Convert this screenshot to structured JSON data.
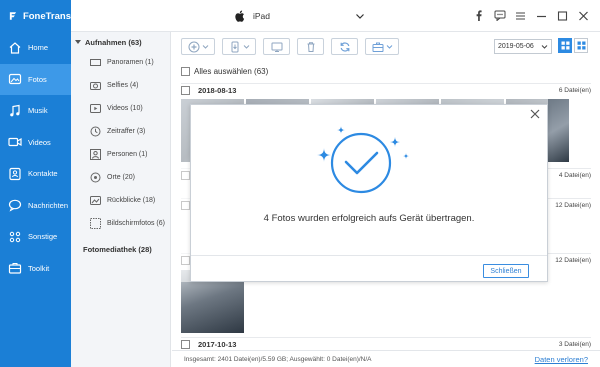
{
  "app": {
    "name": "FoneTrans"
  },
  "device": {
    "name": "iPad"
  },
  "sidebar": {
    "items": [
      {
        "label": "Home",
        "icon": "home-icon"
      },
      {
        "label": "Fotos",
        "icon": "photo-icon",
        "active": true
      },
      {
        "label": "Musik",
        "icon": "music-icon"
      },
      {
        "label": "Videos",
        "icon": "video-icon"
      },
      {
        "label": "Kontakte",
        "icon": "contacts-icon"
      },
      {
        "label": "Nachrichten",
        "icon": "messages-icon"
      },
      {
        "label": "Sonstige",
        "icon": "other-icon"
      },
      {
        "label": "Toolkit",
        "icon": "toolkit-icon"
      }
    ]
  },
  "categories": {
    "header": "Aufnahmen (63)",
    "items": [
      {
        "label": "Panoramen (1)",
        "icon": "panorama-icon"
      },
      {
        "label": "Selfies (4)",
        "icon": "camera-icon"
      },
      {
        "label": "Videos (10)",
        "icon": "video-icon"
      },
      {
        "label": "Zeitraffer (3)",
        "icon": "timelapse-icon"
      },
      {
        "label": "Personen (1)",
        "icon": "person-icon"
      },
      {
        "label": "Orte (20)",
        "icon": "location-icon"
      },
      {
        "label": "Rückblicke (18)",
        "icon": "memories-icon"
      },
      {
        "label": "Bildschirmfotos (6)",
        "icon": "screenshot-icon"
      }
    ],
    "header2": "Fotomediathek (28)"
  },
  "toolbar": {
    "date_value": "2019-05-06"
  },
  "content": {
    "select_all": "Alles auswählen (63)",
    "groups": [
      {
        "date": "2018-08-13",
        "count": "6 Datei(en)"
      },
      {
        "date": "",
        "count": "4 Datei(en)"
      },
      {
        "date": "",
        "count": "12 Datei(en)"
      },
      {
        "date": "",
        "count": "12 Datei(en)"
      },
      {
        "date": "2017-10-13",
        "count": "3 Datei(en)"
      }
    ]
  },
  "status": {
    "text": "Insgesamt: 2401 Datei(en)/5.59 GB; Ausgewählt: 0 Datei(en)/N/A",
    "link": "Daten verloren?"
  },
  "dialog": {
    "message": "4 Fotos wurden erfolgreich aufs Gerät übertragen.",
    "close_button": "Schließen"
  },
  "colors": {
    "accent": "#1b7fd6",
    "sidebar_active": "#3d99e8",
    "dialog_icon": "#2d8ae2"
  }
}
